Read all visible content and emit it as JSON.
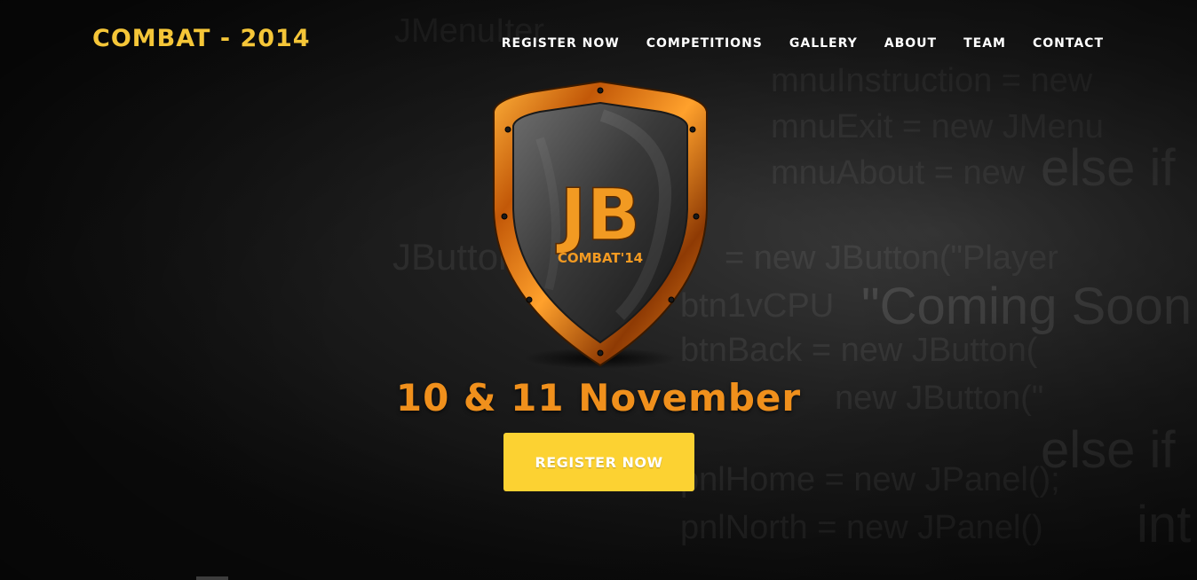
{
  "brand": {
    "title": "COMBAT - 2014"
  },
  "nav": {
    "items": [
      {
        "label": "REGISTER NOW"
      },
      {
        "label": "COMPETITIONS"
      },
      {
        "label": "GALLERY"
      },
      {
        "label": "ABOUT"
      },
      {
        "label": "TEAM"
      },
      {
        "label": "CONTACT"
      }
    ]
  },
  "logo": {
    "monogram": "JB",
    "caption": "COMBAT'14"
  },
  "hero": {
    "date": "10 & 11 November",
    "cta_label": "REGISTER NOW"
  },
  "background_code": [
    "JMenuIter",
    "mnuInstruction = new",
    "mnuExit = new JMenu",
    "mnuAbout = new",
    "else if",
    "JButton",
    "= new JButton(\"Player",
    "btn1vCPU",
    "\"Coming Soon",
    "btnBack = new JButton(",
    "new JButton(\"",
    "else if",
    "pnlHome = new JPanel();",
    "pnlNorth = new JPanel()",
    "int"
  ],
  "colors": {
    "brand": "#f5c638",
    "date": "#f0901c",
    "cta_bg": "#fcd232",
    "nav_text": "#ffffff",
    "background": "#0b0b0b"
  }
}
